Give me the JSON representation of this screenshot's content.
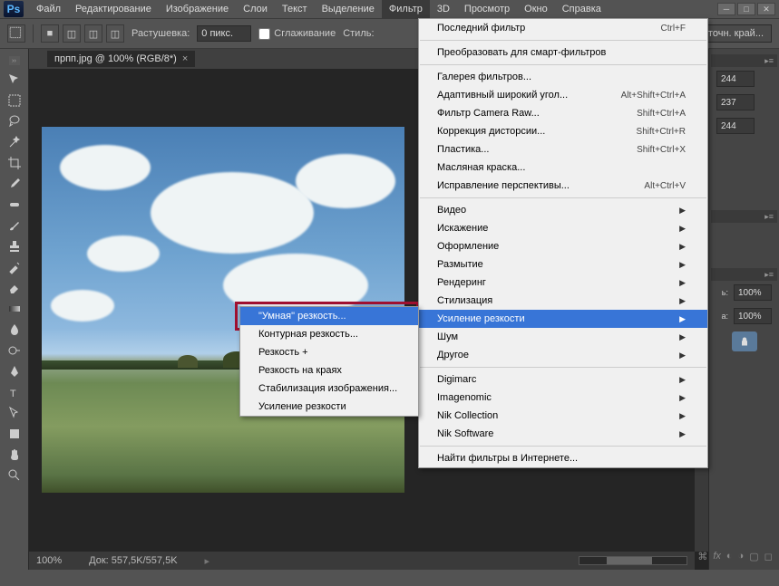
{
  "app": {
    "logo": "Ps"
  },
  "menubar": [
    "Файл",
    "Редактирование",
    "Изображение",
    "Слои",
    "Текст",
    "Выделение",
    "Фильтр",
    "3D",
    "Просмотр",
    "Окно",
    "Справка"
  ],
  "active_menu_index": 6,
  "optionsbar": {
    "feather_label": "Растушевка:",
    "feather_value": "0 пикс.",
    "antialias_label": "Сглаживание",
    "style_label": "Стиль:",
    "refine_label": "Уточн. край..."
  },
  "tab": {
    "title": "прпп.jpg @ 100% (RGB/8*)"
  },
  "filter_menu": {
    "last": {
      "label": "Последний фильтр",
      "shortcut": "Ctrl+F"
    },
    "smart": {
      "label": "Преобразовать для смарт-фильтров"
    },
    "gallery": {
      "label": "Галерея фильтров..."
    },
    "adaptive": {
      "label": "Адаптивный широкий угол...",
      "shortcut": "Alt+Shift+Ctrl+A"
    },
    "camera_raw": {
      "label": "Фильтр Camera Raw...",
      "shortcut": "Shift+Ctrl+A"
    },
    "lens": {
      "label": "Коррекция дисторсии...",
      "shortcut": "Shift+Ctrl+R"
    },
    "liquify": {
      "label": "Пластика...",
      "shortcut": "Shift+Ctrl+X"
    },
    "oil": {
      "label": "Масляная краска..."
    },
    "perspective": {
      "label": "Исправление перспективы...",
      "shortcut": "Alt+Ctrl+V"
    },
    "video": "Видео",
    "distort": "Искажение",
    "render_group": "Оформление",
    "blur": "Размытие",
    "rendering": "Рендеринг",
    "stylize": "Стилизация",
    "sharpen": "Усиление резкости",
    "noise": "Шум",
    "other": "Другое",
    "digimarc": "Digimarc",
    "imagenomic": "Imagenomic",
    "nik_col": "Nik Collection",
    "nik_soft": "Nik Software",
    "browse": "Найти фильтры в Интернете..."
  },
  "sharpen_sub": {
    "smart": "\"Умная\" резкость...",
    "contour": "Контурная резкость...",
    "sharp": "Резкость +",
    "edges": "Резкость на краях",
    "stabilize": "Стабилизация изображения...",
    "more": "Усиление резкости"
  },
  "right_panel": {
    "val1": "244",
    "val2": "237",
    "val3": "244",
    "pct1": "100%",
    "pct2": "100%"
  },
  "statusbar": {
    "zoom": "100%",
    "docsize": "Док: 557,5K/557,5K"
  }
}
